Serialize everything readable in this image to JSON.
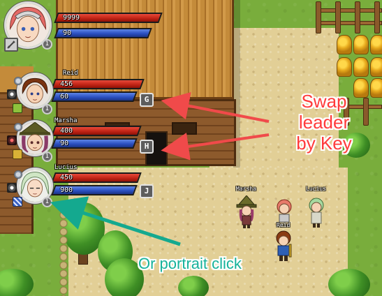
{
  "party": {
    "leader": {
      "hp": "9999",
      "mp": "90",
      "level": "1"
    },
    "members": [
      {
        "name": "Reid",
        "hp": "456",
        "mp": "60",
        "level": "1",
        "key": "G"
      },
      {
        "name": "Marsha",
        "hp": "400",
        "mp": "90",
        "level": "1",
        "key": "H"
      },
      {
        "name": "Lucius",
        "hp": "450",
        "mp": "900",
        "level": "1",
        "key": "J"
      }
    ]
  },
  "field": {
    "sprites": [
      {
        "name": "Marsha"
      },
      {
        "name": "Reid"
      },
      {
        "name": "Lucius"
      }
    ]
  },
  "annotations": {
    "swap_lines": [
      "Swap",
      "leader",
      "by Key"
    ],
    "portrait_click": "Or portrait click"
  },
  "colors": {
    "hp_bar": "#c22416",
    "mp_bar": "#2b50c2",
    "annotation_red": "#ff3b3b",
    "annotation_teal": "#16b29a",
    "arrow_red": "#f04a4a",
    "arrow_teal": "#14a98f"
  }
}
